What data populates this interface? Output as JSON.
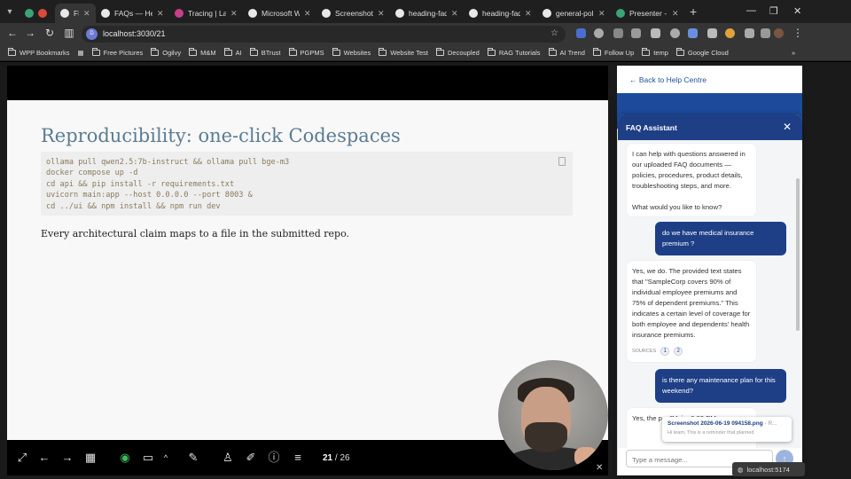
{
  "browser": {
    "tabs": [
      {
        "label": "",
        "fav_color": "#d94a3d"
      },
      {
        "label": "Fl",
        "fav_color": "#e8e8e8"
      },
      {
        "label": "FAQs — Help",
        "fav_color": "#e8e8e8"
      },
      {
        "label": "Tracing | Lan",
        "fav_color": "#c63f8a"
      },
      {
        "label": "Microsoft W",
        "fav_color": "#e8e8e8"
      },
      {
        "label": "Screenshot 2",
        "fav_color": "#e8e8e8"
      },
      {
        "label": "heading-faq",
        "fav_color": "#e8e8e8"
      },
      {
        "label": "heading-faq",
        "fav_color": "#e8e8e8"
      },
      {
        "label": "general-polic",
        "fav_color": "#e8e8e8"
      },
      {
        "label": "Presenter - E",
        "fav_color": "#3aa37a"
      }
    ],
    "url": "localhost:3030/21",
    "site_badge": "D",
    "bookmarks": [
      "WPP Bookmarks",
      "Free Pictures",
      "Ogilvy",
      "M&M",
      "AI",
      "BTrust",
      "PGPMS",
      "Websites",
      "Website Test",
      "Decoupled",
      "RAG Tutorials",
      "AI Trend",
      "Follow Up",
      "temp",
      "Google Cloud"
    ]
  },
  "slide": {
    "title": "Reproducibility: one-click Codespaces",
    "code": [
      "ollama pull qwen2.5:7b-instruct && ollama pull bge-m3",
      "docker compose up -d",
      "cd api && pip install -r requirements.txt",
      "uvicorn main:app --host 0.0.0.0 --port 8003 &",
      "cd ../ui && npm install && npm run dev"
    ],
    "body": "Every architectural claim maps to a file in the submitted repo.",
    "page_current": "21",
    "page_total": "/ 26"
  },
  "help": {
    "back_link": "← Back to Help Centre",
    "hero_title": "FAQ Assistant"
  },
  "faq": {
    "title": "FAQ Assistant",
    "messages": {
      "bot1": "I can help with questions answered in our uploaded FAQ documents — policies, procedures, product details, troubleshooting steps, and more.",
      "bot1b": "What would you like to know?",
      "user1": "do we have  medical insurance premium ?",
      "bot2": "Yes, we do. The provided text states that \"SampleCorp covers 90% of individual employee premiums and 75% of dependent premiums.\" This indicates a certain level of coverage for both employee and dependents' health insurance premiums.",
      "sources_label": "SOURCES",
      "sources": [
        "1",
        "2"
      ],
      "user2": "is there any maintenance plan for this weekend?",
      "bot3": "Yes, the p... \"Mai... 6:00 PM..."
    },
    "input_placeholder": "Type a message..."
  },
  "tooltip": {
    "name": "Screenshot 2026-06-19 094158.png",
    "suffix": "- R...",
    "sub": "Hi team, This is a reminder that planned"
  },
  "status": {
    "text": "localhost:5174"
  }
}
